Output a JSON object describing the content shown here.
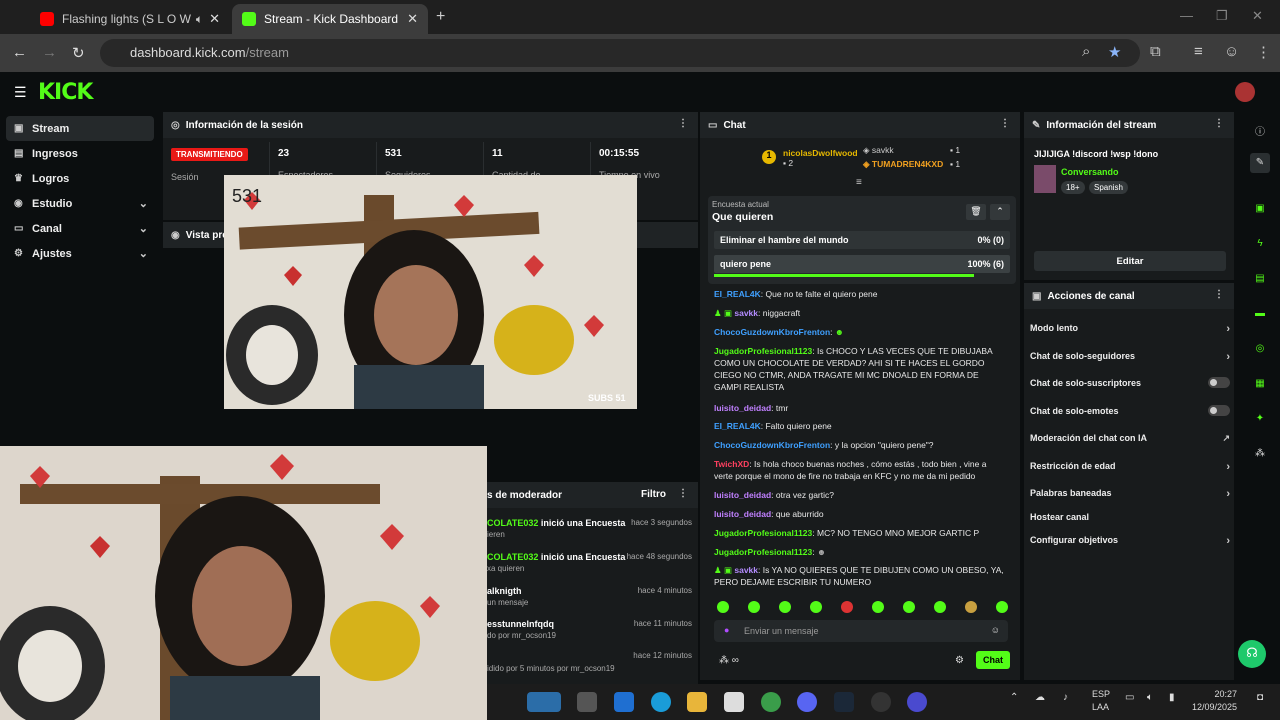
{
  "browser": {
    "tabs": [
      {
        "title": "Flashing lights (S L O W E D"
      },
      {
        "title": "Stream - Kick Dashboard"
      }
    ],
    "url_host": "dashboard.kick.com",
    "url_path": "/stream"
  },
  "kick": {
    "logo": "KICK"
  },
  "sidebar": {
    "items": [
      {
        "label": "Stream"
      },
      {
        "label": "Ingresos"
      },
      {
        "label": "Logros"
      },
      {
        "label": "Estudio"
      },
      {
        "label": "Canal"
      },
      {
        "label": "Ajustes"
      }
    ]
  },
  "session": {
    "title": "Información de la sesión",
    "status_badge": "TRANSMITIENDO",
    "status_label": "Sesión",
    "viewers": "23",
    "viewers_label": "Espectadores",
    "followers": "531",
    "followers_label": "Seguidores",
    "subs": "11",
    "subs_label": "Cantidad de suscripciones",
    "uptime": "00:15:55",
    "uptime_label": "Tiempo en vivo"
  },
  "preview": {
    "title": "Vista previa del stream",
    "overlay_count": "531",
    "subs_overlay": "SUBS 51"
  },
  "chat": {
    "title": "Chat",
    "top1_name": "nicolasDwolfwood",
    "top1_val": "2",
    "top2_name": "savkk",
    "top2_val": "1",
    "top3_name": "TUMADREN4KXD",
    "top3_val": "1",
    "poll_label": "Encuesta actual",
    "poll_question": "Que quieren",
    "poll_opt1": "Eliminar el hambre del mundo",
    "poll_opt1_pct": "0% (0)",
    "poll_opt2": "quiero pene",
    "poll_opt2_pct": "100% (6)",
    "messages": [
      {
        "user": "EI_REAL4K",
        "text": ": Que no te falte el quiero pene"
      },
      {
        "user": "savkk",
        "text": ": niggacraft"
      },
      {
        "user": "ChocoGuzdownKbroFrenton",
        "text": ":"
      },
      {
        "user": "JugadorProfesional1123",
        "text": ": Is CHOCO Y LAS VECES QUE TE DIBUJABA COMO UN CHOCOLATE DE VERDAD? AHI SI TE HACES EL GORDO CIEGO NO CTMR, ANDA TRAGATE MI MC DNOALD EN FORMA DE GAMPI REALISTA"
      },
      {
        "user": "luisito_deidad",
        "text": ": tmr"
      },
      {
        "user": "EI_REAL4K",
        "text": ": Falto quiero pene"
      },
      {
        "user": "ChocoGuzdownKbroFrenton",
        "text": ": y la opcion \"quiero pene\"?"
      },
      {
        "user": "TwichXD",
        "text": ": Is hola choco buenas noches , cómo estás , todo bien , vine a verte porque el mono de fire no trabaja en KFC y no me da mi pedido"
      },
      {
        "user": "luisito_deidad",
        "text": ": otra vez gartic?"
      },
      {
        "user": "luisito_deidad",
        "text": ": que aburrido"
      },
      {
        "user": "JugadorProfesional1123",
        "text": ": MC? NO TENGO MNO MEJOR GARTIC P"
      },
      {
        "user": "JugadorProfesional1123",
        "text": ":"
      },
      {
        "user": "savkk",
        "text": ": Is YA NO QUIERES QUE TE DIBUJEN COMO UN OBESO, YA, PERO DEJAME ESCRIBIR TU NUMERO"
      }
    ],
    "input_placeholder": "Enviar un mensaje",
    "send_label": "Chat"
  },
  "stream_info": {
    "title": "Información del stream",
    "stream_title": "JIJIJIGA !discord !wsp !dono",
    "category": "Conversando",
    "tag1": "18+",
    "tag2": "Spanish",
    "edit": "Editar"
  },
  "channel_actions": {
    "title": "Acciones de canal",
    "items": [
      {
        "label": "Modo lento"
      },
      {
        "label": "Chat de solo-seguidores"
      },
      {
        "label": "Chat de solo-suscriptores"
      },
      {
        "label": "Chat de solo-emotes"
      },
      {
        "label": "Moderación del chat con IA"
      },
      {
        "label": "Restricción de edad"
      },
      {
        "label": "Palabras baneadas"
      },
      {
        "label": "Hostear canal"
      },
      {
        "label": "Configurar objetivos"
      }
    ]
  },
  "modlog": {
    "title": "s de moderador",
    "filter": "Filtro",
    "rows": [
      {
        "user": "COLATE032",
        "action": " inició una Encuesta",
        "sub": "ieren",
        "time": "hace 3 segundos"
      },
      {
        "user": "COLATE032",
        "action": " inició una Encuesta",
        "sub": "xa quieren",
        "time": "hace 48 segundos"
      },
      {
        "user": "alknigth",
        "action": "",
        "sub": "un mensaje",
        "time": "hace 4 minutos"
      },
      {
        "user": "esstunnelnfqdq",
        "action": "",
        "sub": "do por mr_ocson19",
        "time": "hace 11 minutos"
      },
      {
        "user": "",
        "action": "",
        "sub": "idido por 5 minutos por mr_ocson19",
        "time": "hace 12 minutos"
      }
    ]
  },
  "taskbar": {
    "lang1": "ESP",
    "lang2": "LAA",
    "time": "20:27",
    "date": "12/09/2025"
  }
}
